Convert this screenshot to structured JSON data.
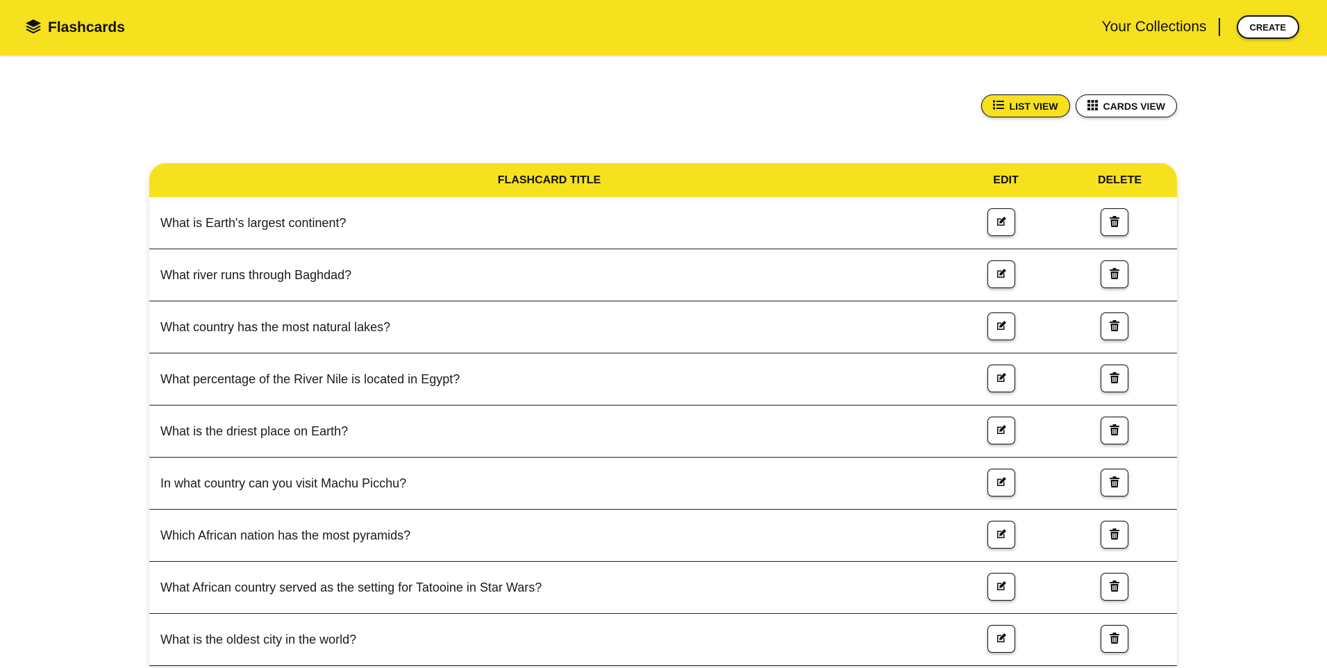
{
  "navbar": {
    "brand_icon": "layers-icon",
    "brand": "Flashcards",
    "collections_link": "Your Collections",
    "create_button": "CREATE",
    "background_color": "#f6e11e"
  },
  "view_toggle": {
    "list_view": {
      "label": "LIST VIEW",
      "icon": "list-icon",
      "active": true
    },
    "cards_view": {
      "label": "CARDS VIEW",
      "icon": "grid-icon",
      "active": false
    }
  },
  "table": {
    "headers": {
      "title": "FLASHCARD TITLE",
      "edit": "EDIT",
      "delete": "DELETE"
    },
    "edit_icon": "edit-icon",
    "delete_icon": "trash-icon",
    "rows": [
      {
        "title": "What is Earth's largest continent?"
      },
      {
        "title": "What river runs through Baghdad?"
      },
      {
        "title": "What country has the most natural lakes?"
      },
      {
        "title": "What percentage of the River Nile is located in Egypt?"
      },
      {
        "title": "What is the driest place on Earth?"
      },
      {
        "title": "In what country can you visit Machu Picchu?"
      },
      {
        "title": "Which African nation has the most pyramids?"
      },
      {
        "title": "What African country served as the setting for Tatooine in Star Wars?"
      },
      {
        "title": "What is the oldest city in the world?"
      }
    ]
  }
}
